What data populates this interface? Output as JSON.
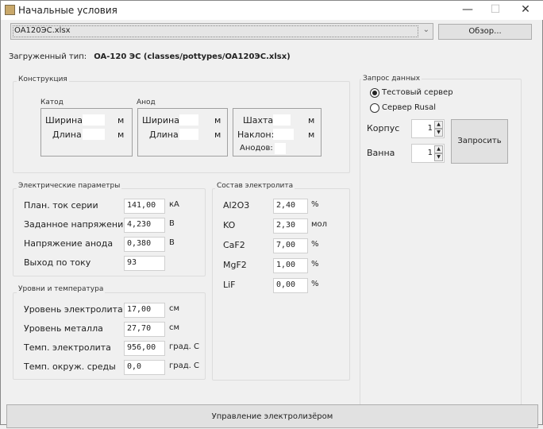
{
  "window": {
    "title": "Начальные условия",
    "minimize": "—",
    "maximize": "☐",
    "close": "✕"
  },
  "file": {
    "selected": "OA120ЭС.xlsx",
    "browse_label": "Обзор..."
  },
  "loaded": {
    "label": "Загруженный тип:",
    "value": "OA-120 ЭС (classes/pottypes/OA120ЭС.xlsx)"
  },
  "construction": {
    "title": "Конструкция",
    "cathode": {
      "title": "Катод",
      "width": "Ширина:",
      "length": "Длина:",
      "unit": "м"
    },
    "anode": {
      "title": "Анод",
      "width": "Ширина:",
      "length": "Длина:",
      "unit": "м"
    },
    "shaft": {
      "shaft": "Шахта:",
      "tilt": "Наклон:",
      "anodes": "Анодов:",
      "unit": "м"
    }
  },
  "request": {
    "title": "Запрос данных",
    "test_server": "Тестовый сервер",
    "rusal_server": "Сервер Rusal",
    "selected": "test",
    "korpus_label": "Корпус",
    "korpus_value": "1",
    "vanna_label": "Ванна",
    "vanna_value": "1",
    "submit": "Запросить"
  },
  "electrical": {
    "title": "Электрические параметры",
    "rows": [
      {
        "label": "План. ток серии",
        "value": "141,00",
        "unit": "кА"
      },
      {
        "label": "Заданное напряжение",
        "value": "4,230",
        "unit": "В"
      },
      {
        "label": "Напряжение анода",
        "value": "0,380",
        "unit": "В"
      },
      {
        "label": "Выход по току",
        "value": "93",
        "unit": ""
      }
    ]
  },
  "levels": {
    "title": "Уровни и температура",
    "rows": [
      {
        "label": "Уровень электролита",
        "value": "17,00",
        "unit": "см"
      },
      {
        "label": "Уровень металла",
        "value": "27,70",
        "unit": "см"
      },
      {
        "label": "Темп. электролита",
        "value": "956,00",
        "unit": "град. С"
      },
      {
        "label": "Темп. окруж. среды",
        "value": "0,0",
        "unit": "град. С"
      }
    ]
  },
  "electrolyte": {
    "title": "Состав электролита",
    "rows": [
      {
        "label": "Al2O3",
        "value": "2,40",
        "unit": "%"
      },
      {
        "label": "KO",
        "value": "2,30",
        "unit": "мол"
      },
      {
        "label": "CaF2",
        "value": "7,00",
        "unit": "%"
      },
      {
        "label": "MgF2",
        "value": "1,00",
        "unit": "%"
      },
      {
        "label": "LiF",
        "value": "0,00",
        "unit": "%"
      }
    ]
  },
  "footer": {
    "manage_label": "Управление электролизёром"
  }
}
